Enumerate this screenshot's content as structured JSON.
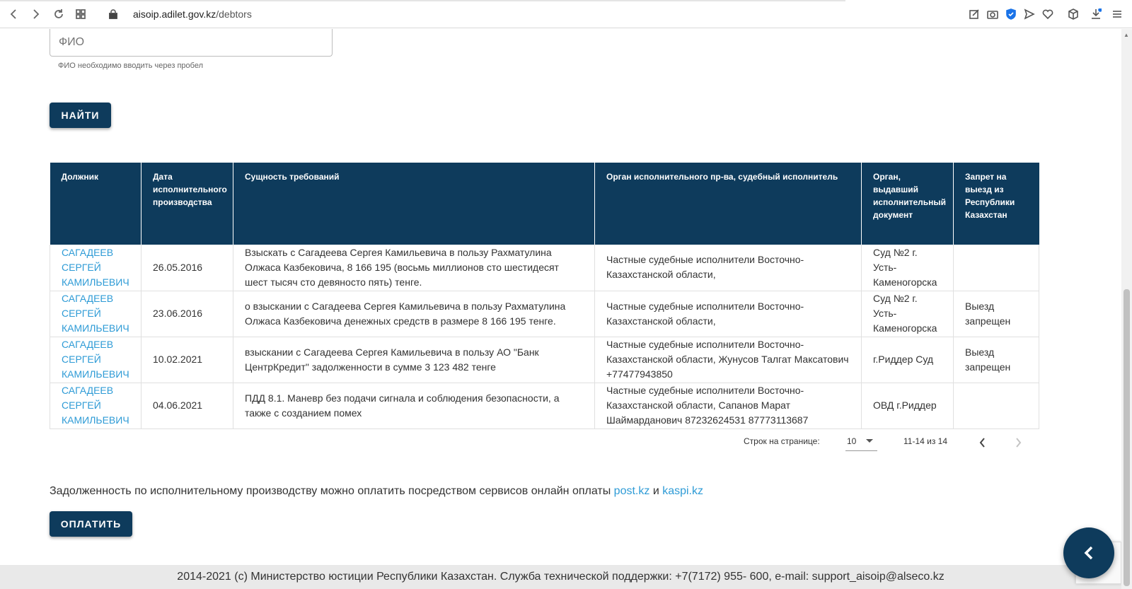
{
  "browser": {
    "url_host": "aisoip.adilet.gov.kz",
    "url_path": "/debtors"
  },
  "search": {
    "fio_placeholder": "ФИО",
    "fio_hint": "ФИО необходимо вводить через пробел",
    "find_button": "НАЙТИ"
  },
  "table": {
    "headers": [
      "Должник",
      "Дата исполнительного производства",
      "Сущность требований",
      "Орган исполнительного пр-ва, судебный исполнитель",
      "Орган, выдавший исполнительный документ",
      "Запрет на выезд из Республики Казахстан"
    ],
    "rows": [
      {
        "debtor": "САГАДЕЕВ СЕРГЕЙ КАМИЛЬЕВИЧ",
        "date": "26.05.2016",
        "essence": "Взыскать с Сагадеева Сергея Камильевича в пользу Рахматулина Олжаса Казбековича, 8 166 195 (восьмь миллионов сто шестидесят шест тысяч сто девяносто пять) тенге.",
        "enforcement_body": "Частные судебные исполнители Восточно-Казахстанской области,",
        "issuing_body": "Суд №2 г. Усть-Каменогорска",
        "travel_ban": ""
      },
      {
        "debtor": "САГАДЕЕВ СЕРГЕЙ КАМИЛЬЕВИЧ",
        "date": "23.06.2016",
        "essence": "о взыскании с Сагадеева Сергея Камильевича в пользу Рахматулина Олжаса Казбековича денежных средств в размере 8 166 195 тенге.",
        "enforcement_body": "Частные судебные исполнители Восточно-Казахстанской области,",
        "issuing_body": "Суд №2 г. Усть-Каменогорска",
        "travel_ban": "Выезд запрещен"
      },
      {
        "debtor": "САГАДЕЕВ СЕРГЕЙ КАМИЛЬЕВИЧ",
        "date": "10.02.2021",
        "essence": "взыскании с Сагадеева Сергея Камильевича в пользу АО \"Банк ЦентрКредит\" задолженности в сумме 3 123 482 тенге",
        "enforcement_body": "Частные судебные исполнители Восточно-Казахстанской области, Жунусов Талгат Максатович +77477943850",
        "issuing_body": "г.Риддер Суд",
        "travel_ban": "Выезд запрещен"
      },
      {
        "debtor": "САГАДЕЕВ СЕРГЕЙ КАМИЛЬЕВИЧ",
        "date": "04.06.2021",
        "essence": "ПДД 8.1. Маневр без подачи сигнала и соблюдения безопасности, а также с созданием помех",
        "enforcement_body": "Частные судебные исполнители Восточно-Казахстанской области, Сапанов Марат Шаймарданович 87232624531 87773113687",
        "issuing_body": "ОВД г.Риддер",
        "travel_ban": ""
      }
    ]
  },
  "pagination": {
    "rows_per_page_label": "Строк на странице:",
    "rows_per_page_value": "10",
    "range": "11-14 из 14"
  },
  "payment": {
    "note": "Задолженность по исполнительному производству можно оплатить посредством сервисов онлайн оплаты",
    "link1": "post.kz",
    "and": "и",
    "link2": "kaspi.kz",
    "pay_button": "ОПЛАТИТЬ"
  },
  "footer": {
    "text": "2014-2021 (с) Министерство юстиции Республики Казахстан. Служба технической поддержки: +7(7172) 955- 600, e-mail: support_aisoip@alseco.kz"
  },
  "colors": {
    "primary": "#0e3b5c",
    "link": "#2e9bd6",
    "danger": "#e53935"
  }
}
